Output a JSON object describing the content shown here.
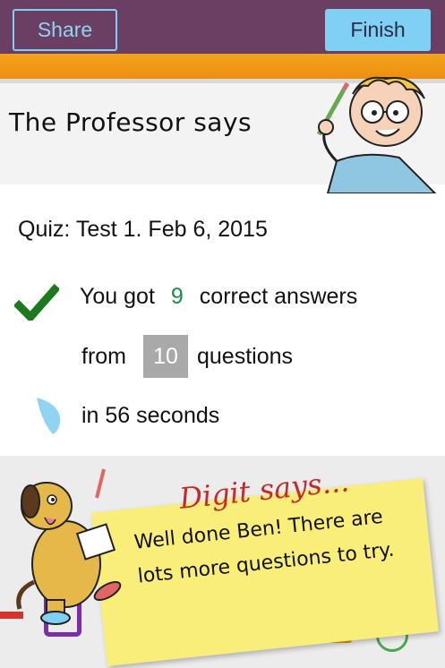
{
  "toolbar": {
    "share_label": "Share",
    "finish_label": "Finish",
    "accent_color": "#7fd0f2",
    "bar_color": "#6a3f63",
    "band_color": "#f4a21c"
  },
  "professor": {
    "title": "The Professor says",
    "icon": "professor-illustration"
  },
  "results": {
    "quiz_title": "Quiz: Test 1. Feb 6, 2015",
    "correct_prefix": "You got",
    "correct_count": "9",
    "correct_suffix": "correct answers",
    "from_label": "from",
    "total_questions": "10",
    "questions_label": "questions",
    "time_text": "in 56 seconds",
    "check_icon": "checkmark-icon",
    "timer_icon": "timer-icon",
    "correct_color": "#1b8a4a"
  },
  "digit": {
    "title": "Digit says...",
    "message": "Well done Ben! There are lots more questions to try.",
    "icon": "dog-illustration"
  }
}
